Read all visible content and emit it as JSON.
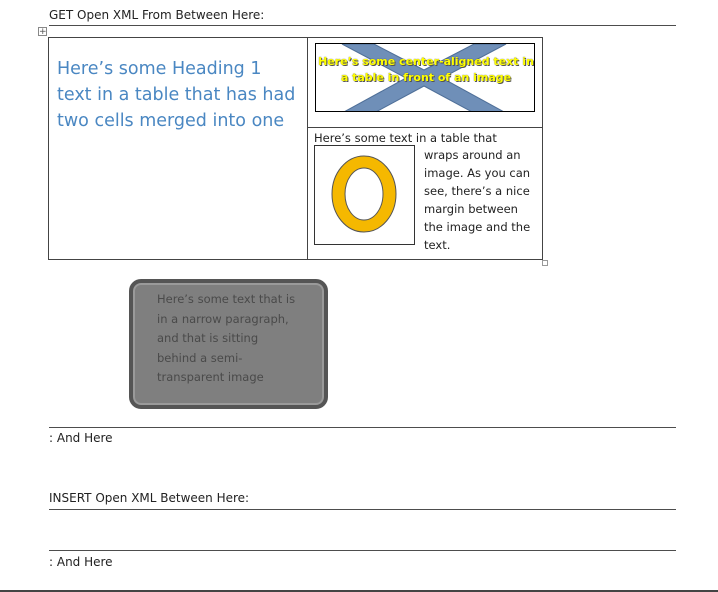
{
  "get_section": {
    "heading": "GET Open XML From Between Here:",
    "end_label": ": And Here"
  },
  "table": {
    "anchor_icon": "move-handle-icon",
    "merged_cell_heading": "Here’s some Heading 1 text in a table that has had two cells merged into one",
    "overlay_text": "Here’s some center-aligned text in a table in front of an image",
    "wrap_cell": {
      "first_line": "Here’s some text in a table that",
      "wrapped_lines": [
        "wraps around an",
        "image. As you can",
        "see, there’s a nice",
        "margin between",
        "the image and the",
        "text."
      ]
    }
  },
  "narrow_paragraph": {
    "lines": [
      "Here’s some text that is",
      "in a narrow paragraph,",
      "and that is sitting",
      "behind a semi-",
      "transparent image"
    ]
  },
  "insert_section": {
    "heading": "INSERT Open XML Between Here:",
    "end_label": ": And Here"
  },
  "colors": {
    "heading1": "#4a87c2",
    "overlay_text": "#ffff00",
    "o_ring": "#f5b800",
    "x_mark": "#6f8fb8",
    "gray_box": "#7f7f7f"
  }
}
